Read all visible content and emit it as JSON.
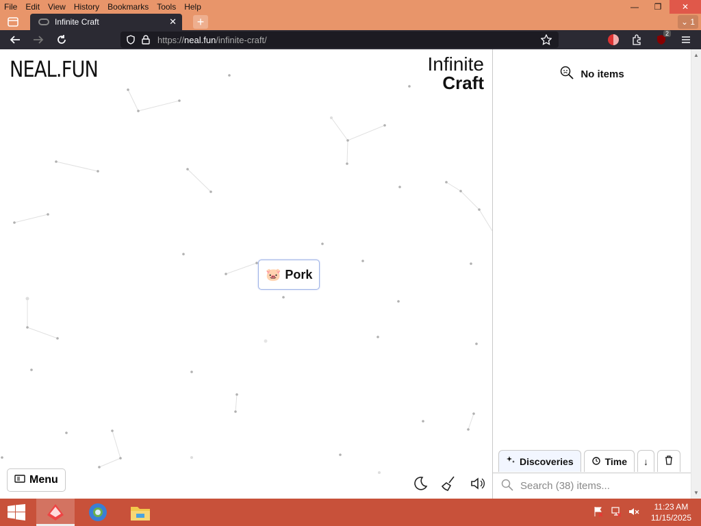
{
  "menubar": {
    "items": [
      "File",
      "Edit",
      "View",
      "History",
      "Bookmarks",
      "Tools",
      "Help"
    ]
  },
  "tabs": {
    "active_title": "Infinite Craft",
    "tab_count": "1"
  },
  "navbar": {
    "url_scheme": "https://",
    "url_host": "neal.fun",
    "url_path": "/infinite-craft/",
    "extension_badge": "2"
  },
  "page": {
    "logo": "NEAL.FUN",
    "title_line1": "Infinite",
    "title_line2": "Craft",
    "canvas_items": [
      {
        "emoji": "🐷",
        "label": "Pork"
      }
    ],
    "menu_label": "Menu"
  },
  "sidebar": {
    "empty_text": "No items",
    "tabs": {
      "discoveries": "Discoveries",
      "time": "Time"
    },
    "search_placeholder": "Search (38) items..."
  },
  "taskbar": {
    "time": "11:23 AM",
    "date": "11/15/2025"
  },
  "colors": {
    "titlebar": "#e8956a",
    "toolbar": "#2b2a33",
    "taskbar": "#c8513a",
    "item_border": "#9fb4e6"
  }
}
